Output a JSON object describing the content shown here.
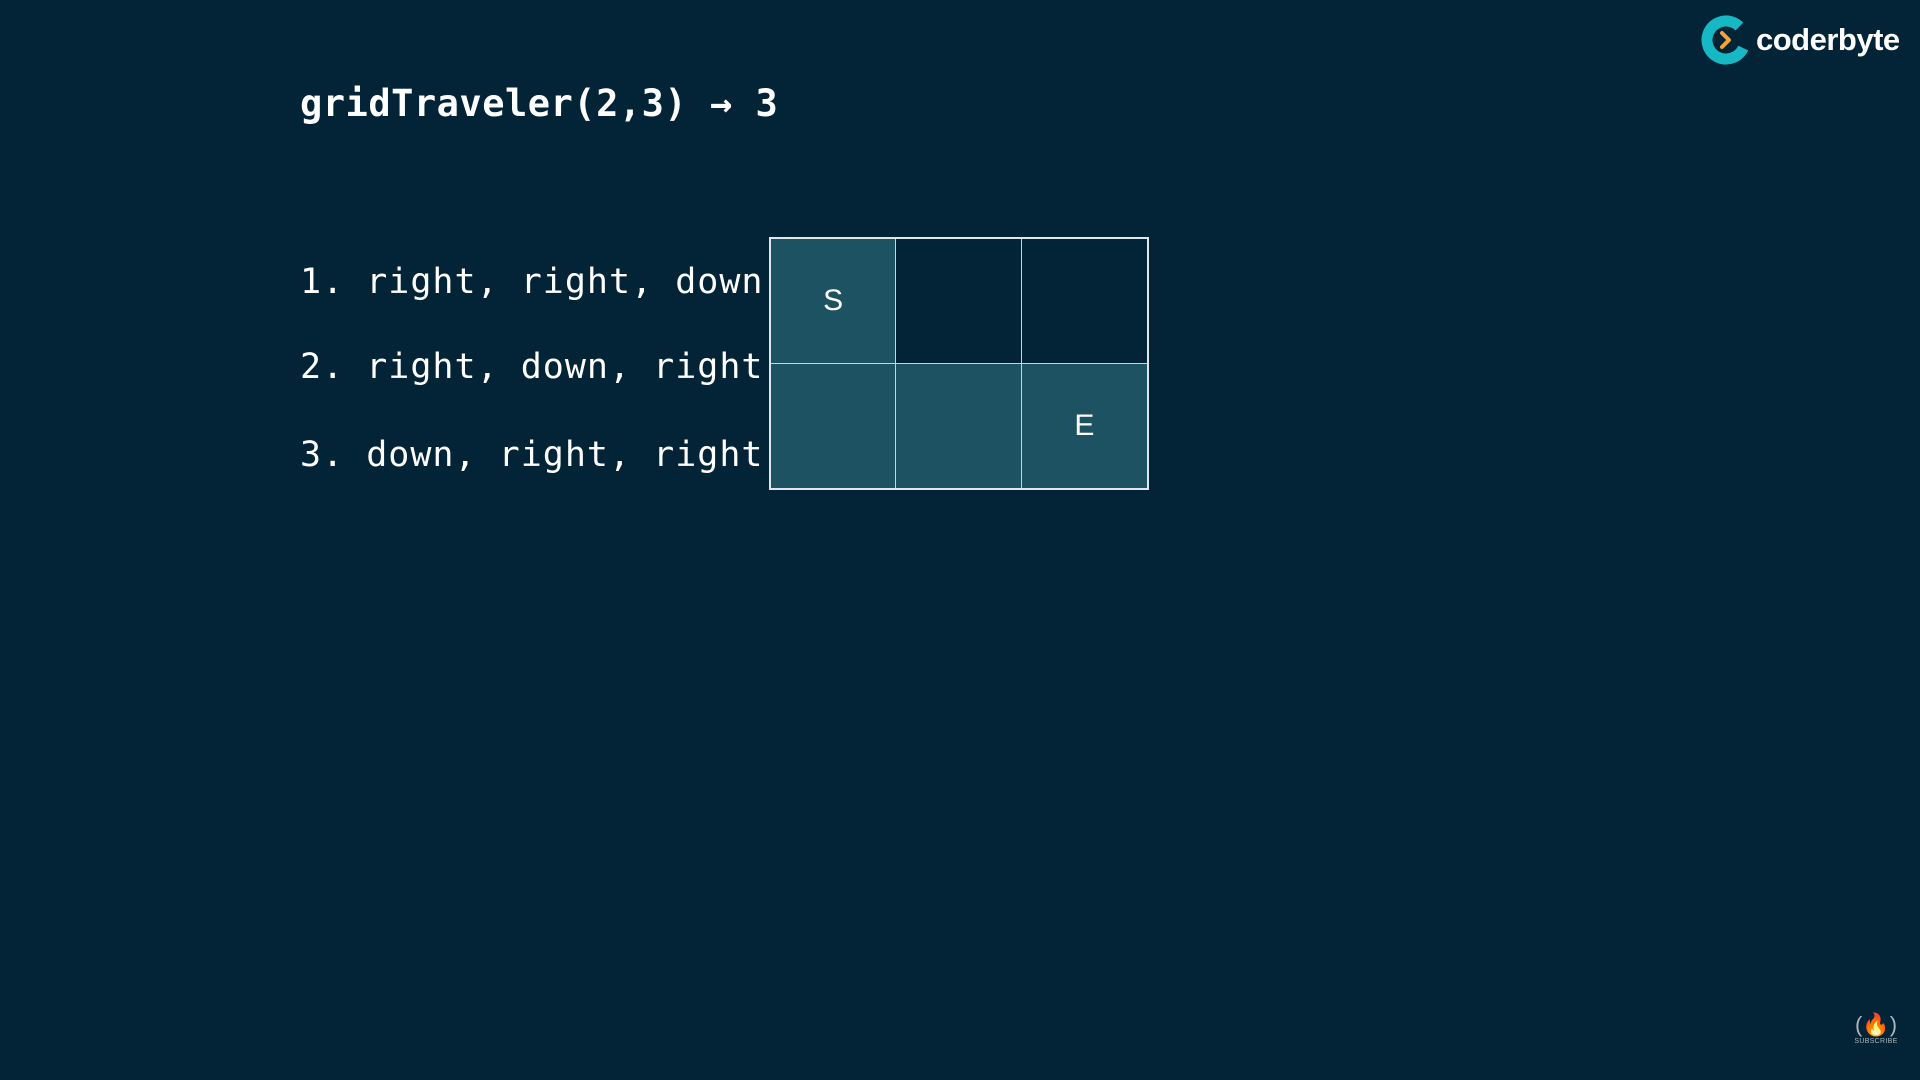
{
  "title": "gridTraveler(2,3) → 3",
  "paths": [
    "1. right, right, down",
    "2. right, down, right",
    "3. down, right, right"
  ],
  "grid": {
    "rows": 2,
    "cols": 3,
    "cells": [
      {
        "label": "S",
        "highlighted": true
      },
      {
        "label": "",
        "highlighted": false
      },
      {
        "label": "",
        "highlighted": false
      },
      {
        "label": "",
        "highlighted": true
      },
      {
        "label": "",
        "highlighted": true
      },
      {
        "label": "E",
        "highlighted": true
      }
    ]
  },
  "logo": {
    "text": "coderbyte",
    "icon": "coderbyte-logo-icon"
  },
  "watermark": {
    "icon": "freecodecamp-logo-icon",
    "label": "SUBSCRIBE"
  },
  "colors": {
    "background": "#032336",
    "highlight_cell": "#1d5262",
    "logo_accent": "#16b8c4",
    "logo_chevron": "#f2a33c"
  }
}
